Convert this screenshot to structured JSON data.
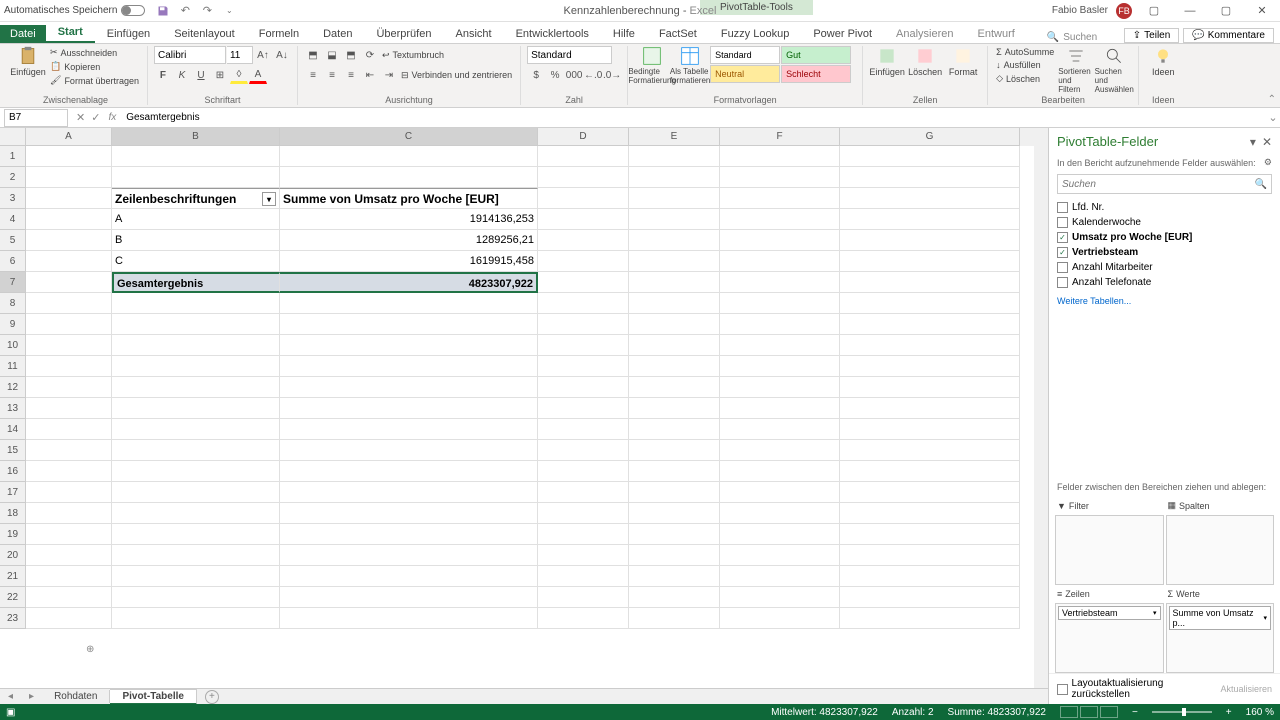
{
  "titlebar": {
    "autosave_label": "Automatisches Speichern",
    "doc_name": "Kennzahlenberechnung",
    "app_name": "Excel",
    "pivot_tools": "PivotTable-Tools",
    "user": "Fabio Basler",
    "user_initials": "FB"
  },
  "tabs": {
    "file": "Datei",
    "items": [
      "Start",
      "Einfügen",
      "Seitenlayout",
      "Formeln",
      "Daten",
      "Überprüfen",
      "Ansicht",
      "Entwicklertools",
      "Hilfe",
      "FactSet",
      "Fuzzy Lookup",
      "Power Pivot",
      "Analysieren",
      "Entwurf"
    ],
    "active": "Start",
    "search": "Suchen",
    "share": "Teilen",
    "comments": "Kommentare"
  },
  "ribbon": {
    "paste": "Einfügen",
    "cut": "Ausschneiden",
    "copy": "Kopieren",
    "format_painter": "Format übertragen",
    "clipboard": "Zwischenablage",
    "font_name": "Calibri",
    "font_size": "11",
    "font": "Schriftart",
    "wrap": "Textumbruch",
    "merge": "Verbinden und zentrieren",
    "alignment": "Ausrichtung",
    "num_format": "Standard",
    "number": "Zahl",
    "cond_format": "Bedingte Formatierung",
    "as_table": "Als Tabelle formatieren",
    "styles": {
      "standard": "Standard",
      "gut": "Gut",
      "neutral": "Neutral",
      "schlecht": "Schlecht"
    },
    "styles_label": "Formatvorlagen",
    "insert": "Einfügen",
    "delete": "Löschen",
    "format": "Format",
    "cells": "Zellen",
    "autosum": "AutoSumme",
    "fill": "Ausfüllen",
    "clear": "Löschen",
    "sort": "Sortieren und Filtern",
    "find": "Suchen und Auswählen",
    "editing": "Bearbeiten",
    "ideas": "Ideen",
    "ideas_label": "Ideen"
  },
  "formula": {
    "cell_ref": "B7",
    "value": "Gesamtergebnis"
  },
  "columns": [
    "A",
    "B",
    "C",
    "D",
    "E",
    "F",
    "G"
  ],
  "pivot": {
    "row_header": "Zeilenbeschriftungen",
    "val_header": "Summe von Umsatz pro Woche [EUR]",
    "rows": [
      {
        "label": "A",
        "value": "1914136,253"
      },
      {
        "label": "B",
        "value": "1289256,21"
      },
      {
        "label": "C",
        "value": "1619915,458"
      }
    ],
    "total_label": "Gesamtergebnis",
    "total_value": "4823307,922"
  },
  "sheets": {
    "tabs": [
      "Rohdaten",
      "Pivot-Tabelle"
    ],
    "active": "Pivot-Tabelle"
  },
  "status": {
    "avg_label": "Mittelwert:",
    "avg": "4823307,922",
    "count_label": "Anzahl:",
    "count": "2",
    "sum_label": "Summe:",
    "sum": "4823307,922",
    "zoom": "160 %"
  },
  "taskpane": {
    "title": "PivotTable-Felder",
    "subtext": "In den Bericht aufzunehmende Felder auswählen:",
    "search_placeholder": "Suchen",
    "fields": [
      {
        "name": "Lfd. Nr.",
        "checked": false
      },
      {
        "name": "Kalenderwoche",
        "checked": false
      },
      {
        "name": "Umsatz pro Woche [EUR]",
        "checked": true
      },
      {
        "name": "Vertriebsteam",
        "checked": true
      },
      {
        "name": "Anzahl Mitarbeiter",
        "checked": false
      },
      {
        "name": "Anzahl Telefonate",
        "checked": false
      }
    ],
    "more_tables": "Weitere Tabellen...",
    "drag_hint": "Felder zwischen den Bereichen ziehen und ablegen:",
    "zones": {
      "filter": "Filter",
      "columns": "Spalten",
      "rows": "Zeilen",
      "values": "Werte"
    },
    "row_item": "Vertriebsteam",
    "val_item": "Summe von Umsatz p...",
    "defer": "Layoutaktualisierung zurückstellen",
    "refresh": "Aktualisieren"
  }
}
